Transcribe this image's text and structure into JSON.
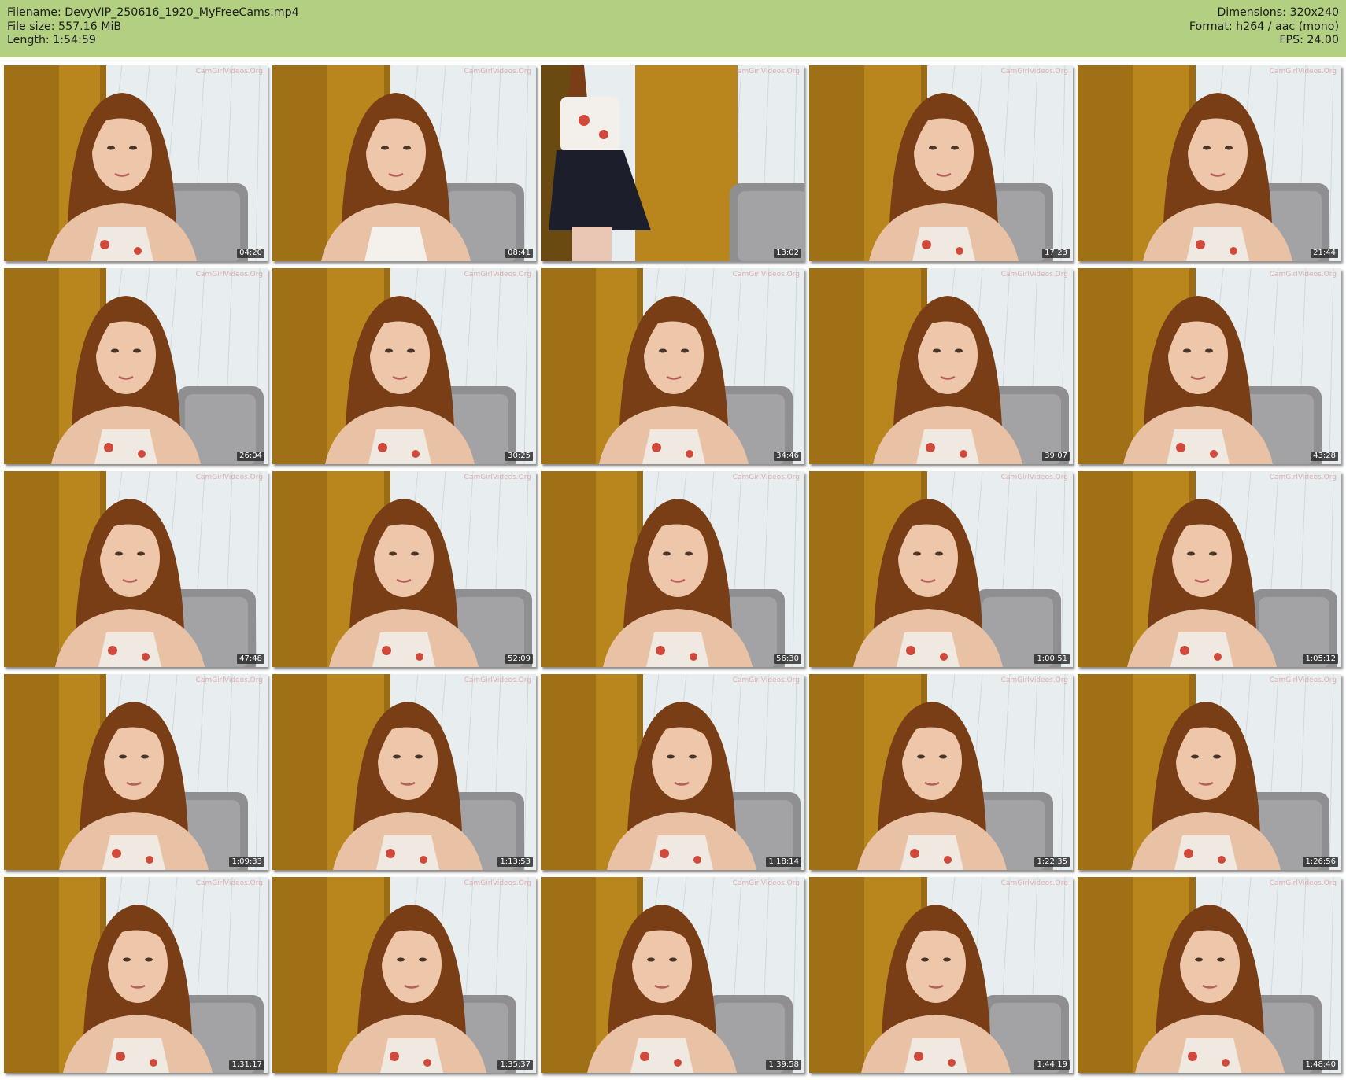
{
  "header": {
    "filename": "Filename: DevyVIP_250616_1920_MyFreeCams.mp4",
    "file_size": "File size: 557.16 MiB",
    "length": "Length: 1:54:59",
    "dimensions": "Dimensions: 320x240",
    "format": "Format: h264 / aac (mono)",
    "fps": "FPS: 24.00"
  },
  "colors": {
    "header_bg": "#b3cf82",
    "door": "#b8861c",
    "wall": "#e8eef0",
    "chair": "#8f8f92",
    "hair": "#7a3e17"
  },
  "thumbnails": [
    {
      "timestamp": "04:20",
      "watermark": "CamGirlVideos.Org"
    },
    {
      "timestamp": "08:41",
      "watermark": "CamGirlVideos.Org"
    },
    {
      "timestamp": "13:02",
      "watermark": "CamGirlVideos.Org"
    },
    {
      "timestamp": "17:23",
      "watermark": "CamGirlVideos.Org"
    },
    {
      "timestamp": "21:44",
      "watermark": "CamGirlVideos.Org"
    },
    {
      "timestamp": "26:04",
      "watermark": "CamGirlVideos.Org"
    },
    {
      "timestamp": "30:25",
      "watermark": "CamGirlVideos.Org"
    },
    {
      "timestamp": "34:46",
      "watermark": "CamGirlVideos.Org"
    },
    {
      "timestamp": "39:07",
      "watermark": "CamGirlVideos.Org"
    },
    {
      "timestamp": "43:28",
      "watermark": "CamGirlVideos.Org"
    },
    {
      "timestamp": "47:48",
      "watermark": "CamGirlVideos.Org"
    },
    {
      "timestamp": "52:09",
      "watermark": "CamGirlVideos.Org"
    },
    {
      "timestamp": "56:30",
      "watermark": "CamGirlVideos.Org"
    },
    {
      "timestamp": "1:00:51",
      "watermark": "CamGirlVideos.Org"
    },
    {
      "timestamp": "1:05:12",
      "watermark": "CamGirlVideos.Org"
    },
    {
      "timestamp": "1:09:33",
      "watermark": "CamGirlVideos.Org"
    },
    {
      "timestamp": "1:13:53",
      "watermark": "CamGirlVideos.Org"
    },
    {
      "timestamp": "1:18:14",
      "watermark": "CamGirlVideos.Org"
    },
    {
      "timestamp": "1:22:35",
      "watermark": "CamGirlVideos.Org"
    },
    {
      "timestamp": "1:26:56",
      "watermark": "CamGirlVideos.Org"
    },
    {
      "timestamp": "1:31:17",
      "watermark": "CamGirlVideos.Org"
    },
    {
      "timestamp": "1:35:37",
      "watermark": "CamGirlVideos.Org"
    },
    {
      "timestamp": "1:39:58",
      "watermark": "CamGirlVideos.Org"
    },
    {
      "timestamp": "1:44:19",
      "watermark": "CamGirlVideos.Org"
    },
    {
      "timestamp": "1:48:40",
      "watermark": "CamGirlVideos.Org"
    }
  ]
}
